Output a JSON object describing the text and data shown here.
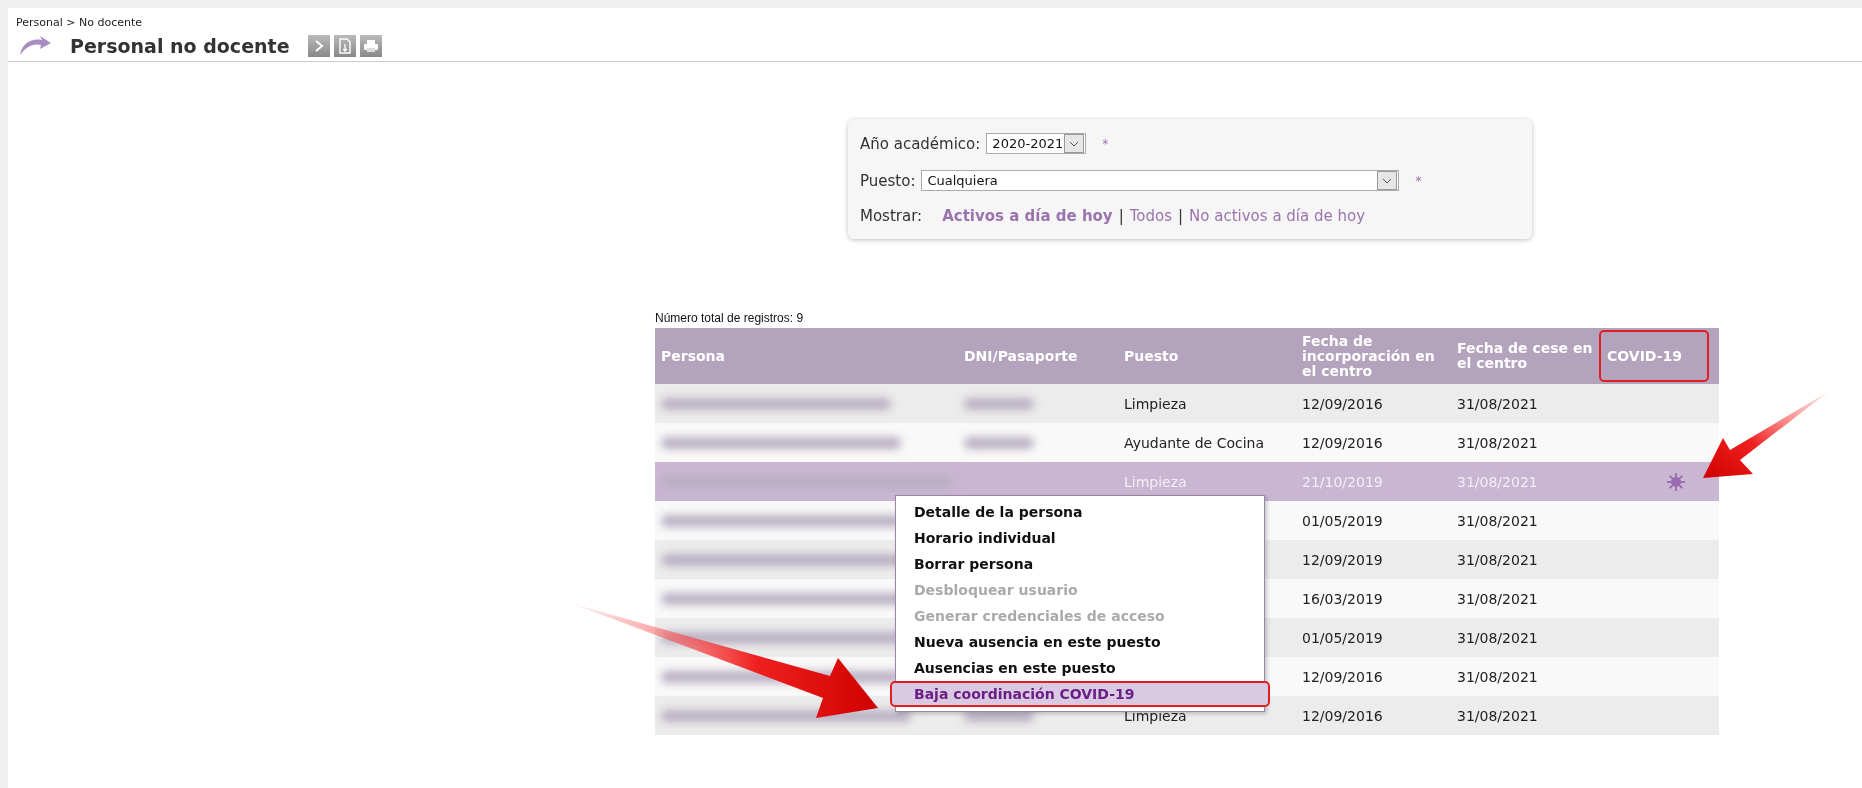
{
  "breadcrumb": "Personal > No docente",
  "title": "Personal no docente",
  "filters": {
    "year": {
      "label": "Año académico:",
      "value": "2020-2021",
      "required_mark": "*"
    },
    "position": {
      "label": "Puesto:",
      "value": "Cualquiera",
      "required_mark": "*"
    },
    "show": {
      "label": "Mostrar:",
      "options": [
        {
          "label": "Activos a día de hoy",
          "selected": true
        },
        {
          "label": "Todos",
          "selected": false
        },
        {
          "label": "No activos a día de hoy",
          "selected": false
        }
      ],
      "separators": [
        "|",
        "|"
      ]
    }
  },
  "total": "Número total de registros: 9",
  "columns": [
    {
      "label": "Persona",
      "highlighted": false
    },
    {
      "label": "DNI/Pasaporte",
      "highlighted": false
    },
    {
      "label": "Puesto",
      "highlighted": false
    },
    {
      "label": "Fecha de incorporación en el centro",
      "highlighted": false
    },
    {
      "label": "Fecha de cese en el centro",
      "highlighted": false
    },
    {
      "label": "COVID-19",
      "highlighted": true
    }
  ],
  "rows": [
    {
      "puesto": "Limpieza",
      "incorporacion": "12/09/2016",
      "cese": "31/08/2021",
      "selected": false,
      "covid": false
    },
    {
      "puesto": "Ayudante de Cocina",
      "incorporacion": "12/09/2016",
      "cese": "31/08/2021",
      "selected": false,
      "covid": false
    },
    {
      "puesto": "Limpieza",
      "incorporacion": "21/10/2019",
      "cese": "31/08/2021",
      "selected": true,
      "covid": true
    },
    {
      "incorporacion": "01/05/2019",
      "cese": "31/08/2021",
      "selected": false,
      "covid": false
    },
    {
      "incorporacion": "12/09/2019",
      "cese": "31/08/2021",
      "selected": false,
      "covid": false
    },
    {
      "incorporacion": "16/03/2019",
      "cese": "31/08/2021",
      "selected": false,
      "covid": false
    },
    {
      "incorporacion": "01/05/2019",
      "cese": "31/08/2021",
      "selected": false,
      "covid": false
    },
    {
      "incorporacion": "12/09/2016",
      "cese": "31/08/2021",
      "selected": false,
      "covid": false
    },
    {
      "puesto": "Limpieza",
      "incorporacion": "12/09/2016",
      "cese": "31/08/2021",
      "selected": false,
      "covid": false
    }
  ],
  "context_menu": [
    {
      "label": "Detalle de la persona",
      "disabled": false,
      "selected": false
    },
    {
      "label": "Horario individual",
      "disabled": false,
      "selected": false
    },
    {
      "label": "Borrar persona",
      "disabled": false,
      "selected": false
    },
    {
      "label": "Desbloquear usuario",
      "disabled": true,
      "selected": false
    },
    {
      "label": "Generar credenciales de acceso",
      "disabled": true,
      "selected": false
    },
    {
      "label": "Nueva ausencia en este puesto",
      "disabled": false,
      "selected": false
    },
    {
      "label": "Ausencias en este puesto",
      "disabled": false,
      "selected": false
    },
    {
      "label": "Baja coordinación COVID-19",
      "disabled": false,
      "selected": true
    }
  ]
}
